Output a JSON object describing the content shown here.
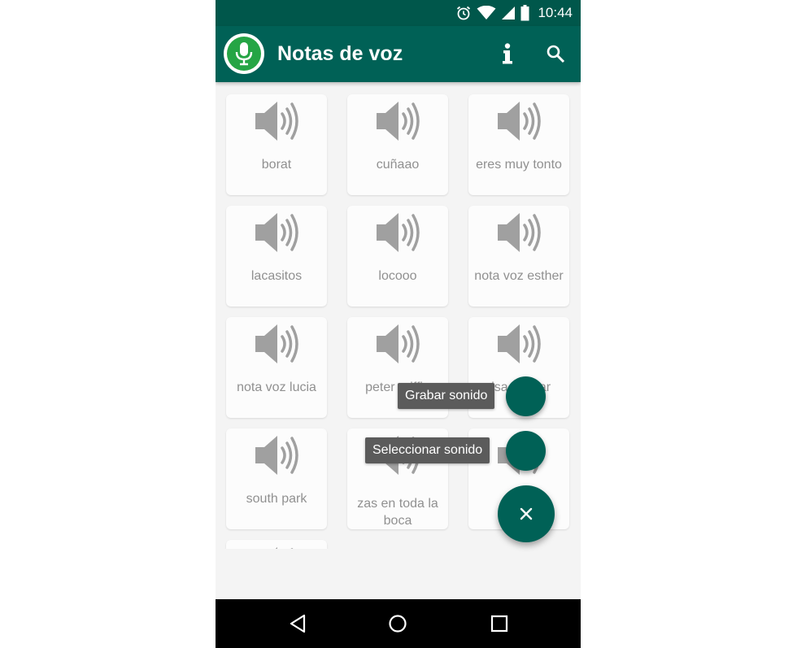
{
  "status_bar": {
    "time": "10:44",
    "icons": [
      "alarm-icon",
      "wifi-icon",
      "signal-icon",
      "battery-icon"
    ]
  },
  "app_bar": {
    "title": "Notas de voz",
    "logo_icon": "microphone-icon",
    "actions": [
      "info-icon",
      "search-icon"
    ]
  },
  "sounds": [
    {
      "label": "borat"
    },
    {
      "label": "cuñaao"
    },
    {
      "label": "eres muy tonto"
    },
    {
      "label": "lacasitos"
    },
    {
      "label": "locooo"
    },
    {
      "label": "nota voz esther"
    },
    {
      "label": "nota voz lucia"
    },
    {
      "label": "peter griffin"
    },
    {
      "label": "risa malvar"
    },
    {
      "label": "south park"
    },
    {
      "label": "zas en toda la boca"
    },
    {
      "label": ""
    }
  ],
  "fab_menu": {
    "record_label": "Grabar sonido",
    "select_label": "Seleccionar sonido",
    "close_symbol": "×"
  },
  "colors": {
    "primary": "#006156",
    "primary_dark": "#00574b",
    "logo_green": "#25a545",
    "speaker_gray": "#6e6e6e"
  }
}
